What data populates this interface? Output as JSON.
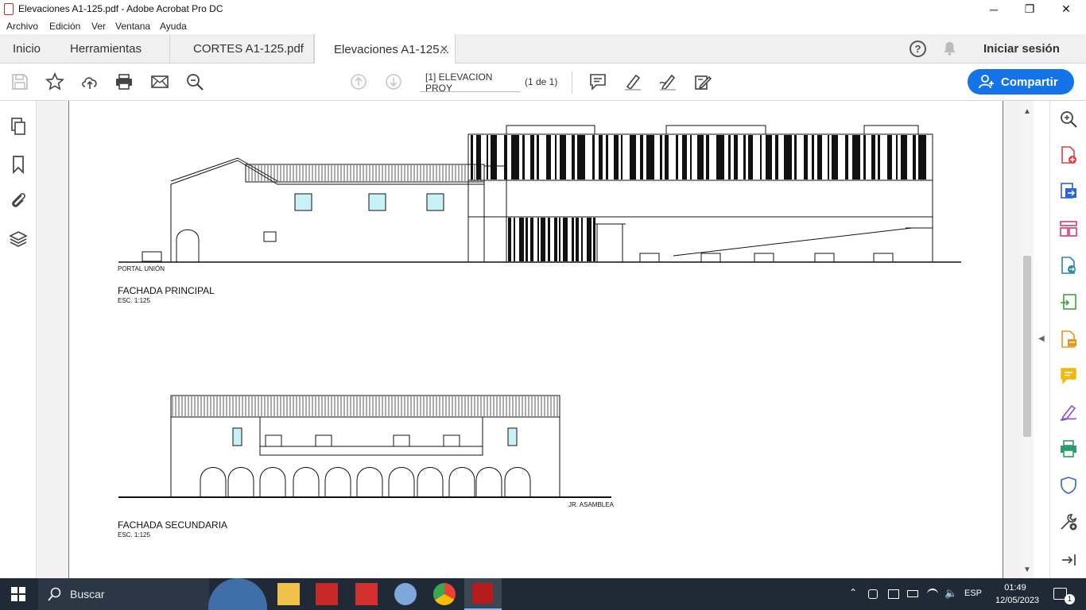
{
  "window": {
    "title": "Elevaciones A1-125.pdf - Adobe Acrobat Pro DC",
    "minimize": "─",
    "maximize": "❐",
    "close": "✕"
  },
  "menu": [
    "Archivo",
    "Edición",
    "Ver",
    "Ventana",
    "Ayuda"
  ],
  "tabs": {
    "home": "Inicio",
    "tools": "Herramientas",
    "files": [
      {
        "label": "CORTES A1-125.pdf",
        "active": false
      },
      {
        "label": "Elevaciones A1-125...",
        "active": true,
        "close": "✕"
      }
    ]
  },
  "header": {
    "help": "?",
    "signin": "Iniciar sesión"
  },
  "toolbar": {
    "page_field": "[1] ELEVACION PROY",
    "page_count": "(1 de 1)",
    "share_label": "Compartir",
    "icons": [
      "save-icon",
      "star-icon",
      "upload-icon",
      "print-icon",
      "mail-icon",
      "zoom-icon",
      "page-up-icon",
      "page-down-icon",
      "comment-icon",
      "highlight-icon",
      "sign-icon",
      "edit-icon"
    ]
  },
  "accent_color": "#1473e6",
  "document": {
    "drawing1": {
      "label_street": "PORTAL UNIÓN",
      "title": "FACHADA PRINCIPAL",
      "scale": "ESC. 1:125"
    },
    "drawing2": {
      "label_street": "JR. ASAMBLEA",
      "title": "FACHADA SECUNDARIA",
      "scale": "ESC. 1:125"
    }
  },
  "taskbar": {
    "search_placeholder": "Buscar",
    "lang": "ESP",
    "time": "01:49",
    "date": "12/05/2023",
    "notifications": "1"
  }
}
